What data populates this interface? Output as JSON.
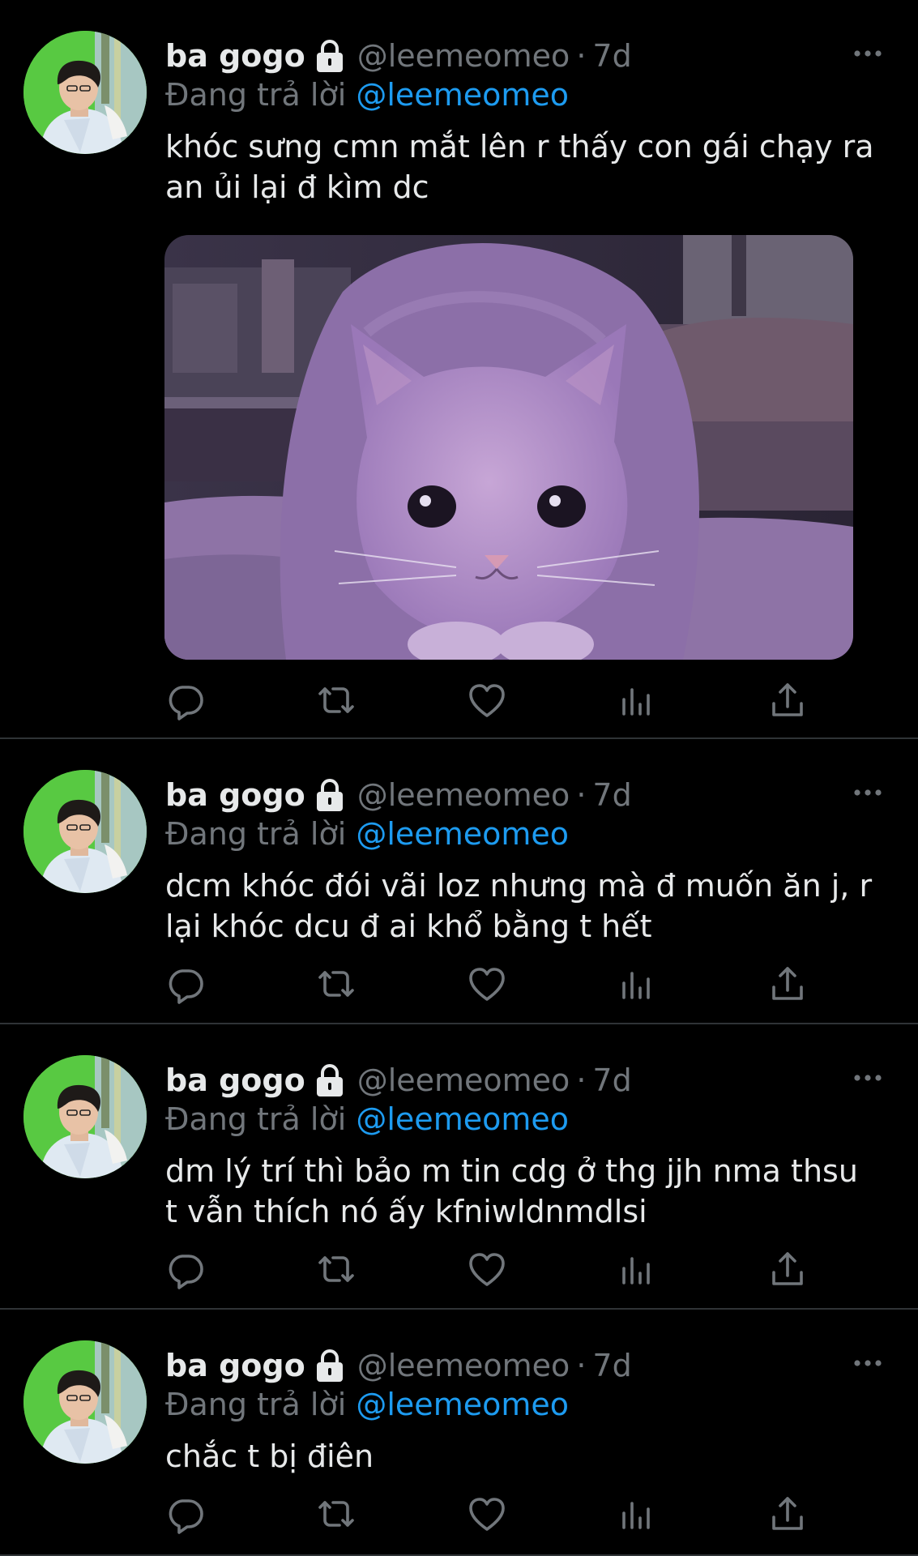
{
  "colors": {
    "background": "#000000",
    "text": "#e7e9ea",
    "muted": "#71767b",
    "link": "#1d9bf0",
    "divider": "#2f3336"
  },
  "icons": {
    "lock": "lock-icon",
    "more": "more-icon",
    "reply": "reply-icon",
    "retweet": "retweet-icon",
    "like": "heart-icon",
    "views": "views-icon",
    "share": "share-icon"
  },
  "tweets": [
    {
      "display_name": "ba gogo",
      "handle": "@leemeomeo",
      "separator": "·",
      "time": "7d",
      "replying_prefix": "Đang trả lời",
      "replying_to": "@leemeomeo",
      "text": "khóc sưng cmn mắt lên r thấy con gái chạy ra an ủi lại đ kìm dc",
      "has_media": true
    },
    {
      "display_name": "ba gogo",
      "handle": "@leemeomeo",
      "separator": "·",
      "time": "7d",
      "replying_prefix": "Đang trả lời",
      "replying_to": "@leemeomeo",
      "text": "dcm khóc đói vãi loz nhưng mà đ muốn ăn j, r lại khóc dcu đ ai khổ bằng t hết",
      "has_media": false
    },
    {
      "display_name": "ba gogo",
      "handle": "@leemeomeo",
      "separator": "·",
      "time": "7d",
      "replying_prefix": "Đang trả lời",
      "replying_to": "@leemeomeo",
      "text": "dm lý trí thì bảo m tin cdg ở thg jjh nma thsu t vẫn thích nó ấy kfniwldnmdlsi",
      "has_media": false
    },
    {
      "display_name": "ba gogo",
      "handle": "@leemeomeo",
      "separator": "·",
      "time": "7d",
      "replying_prefix": "Đang trả lời",
      "replying_to": "@leemeomeo",
      "text": "chắc t bị điên",
      "has_media": false
    }
  ]
}
